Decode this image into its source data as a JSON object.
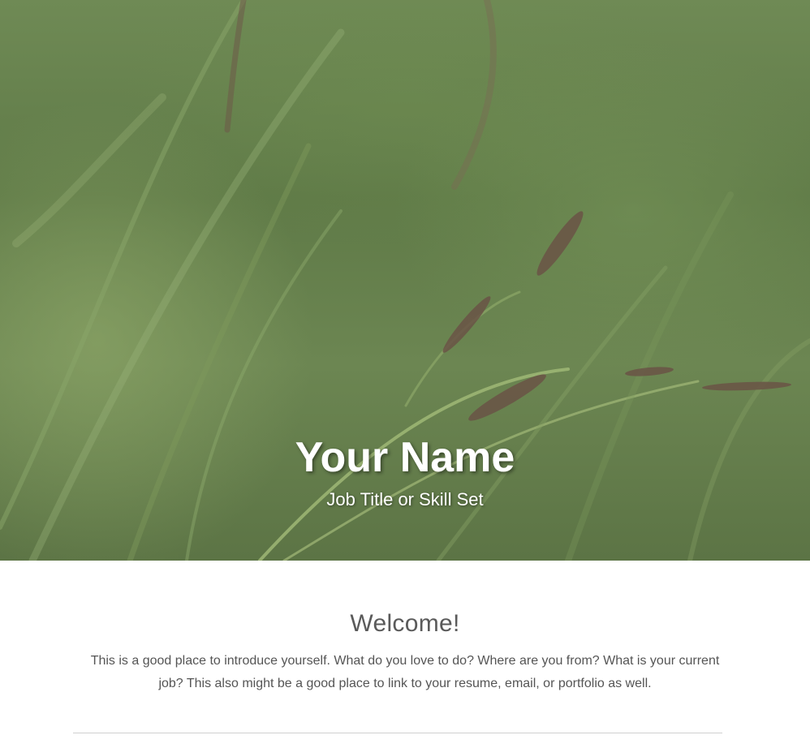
{
  "hero": {
    "name": "Your Name",
    "subtitle": "Job Title or Skill Set"
  },
  "welcome": {
    "heading": "Welcome!",
    "body": "This is a good place to introduce yourself. What do you love to do? Where are you from? What is your current job? This also might be a good place to link to your resume, email, or portfolio as well."
  },
  "colors": {
    "hero_text": "#ffffff",
    "heading_text": "#5a5a5a",
    "body_text": "#555555",
    "divider": "#cfcfcf"
  }
}
